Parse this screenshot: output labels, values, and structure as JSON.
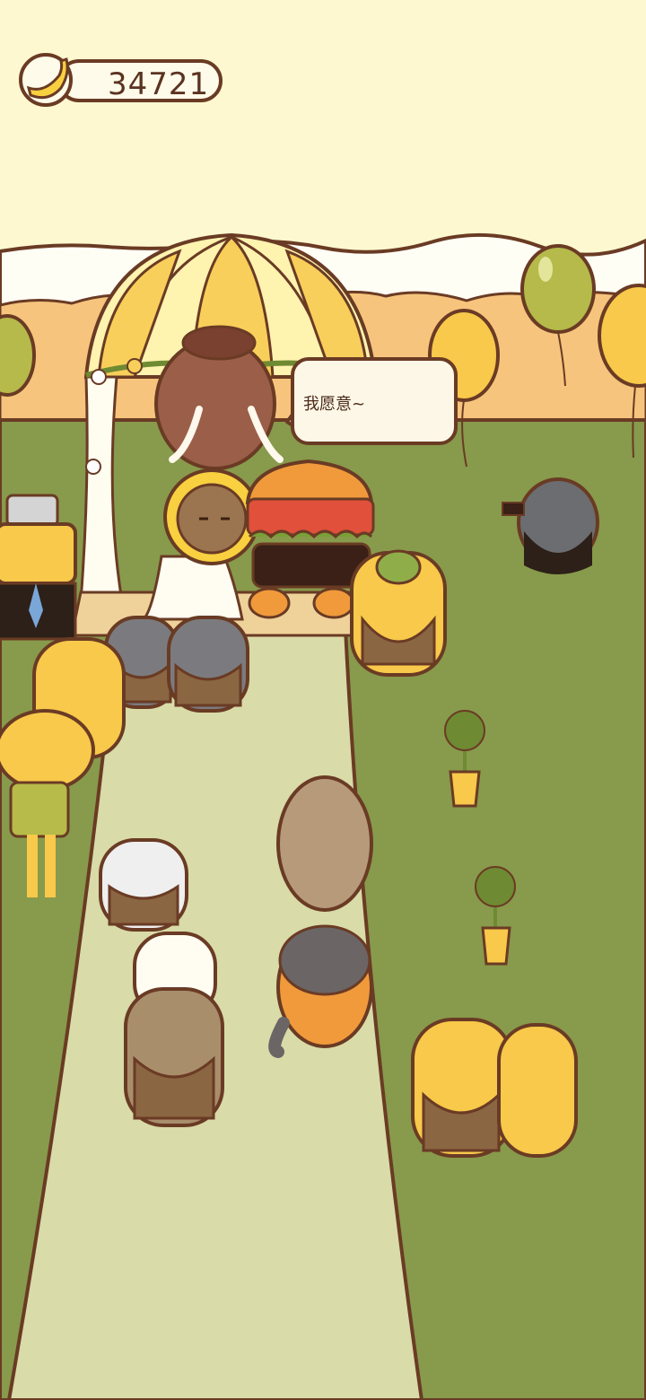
{
  "hud": {
    "banana_count": "34721",
    "currency_icon": "banana-icon"
  },
  "scene": {
    "speech_bubble_text": "我愿意~"
  },
  "colors": {
    "sky": "#fdf8cf",
    "grass": "#889a4c",
    "aisle": "#d9dba8",
    "outline": "#6a3b24",
    "hills": "#f6c47c",
    "balloon_yellow": "#f8c94a",
    "balloon_green": "#b5ba4a"
  }
}
